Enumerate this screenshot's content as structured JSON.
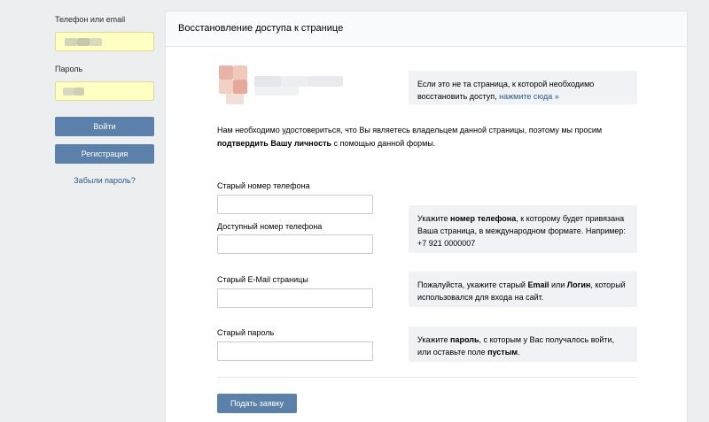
{
  "login": {
    "phone_label": "Телефон или email",
    "phone_value": "",
    "password_label": "Пароль",
    "password_value": "",
    "login_button": "Войти",
    "register_button": "Регистрация",
    "forgot_link": "Забыли пароль?",
    "input_bg_color": "#ffffc4"
  },
  "panel": {
    "title": "Восстановление доступа к странице"
  },
  "notice": {
    "text": "Если это не та страница, к которой необходимо восстановить доступ, ",
    "link": "нажмите сюда »"
  },
  "intro": {
    "part1": "Нам необходимо удостовериться, что Вы являетесь владельцем данной страницы, поэтому мы просим ",
    "bold": "подтвердить Вашу личность",
    "part2": " с помощью данной формы."
  },
  "form": {
    "old_phone_label": "Старый номер телефона",
    "available_phone_label": "Доступный номер телефона",
    "old_email_label": "Старый E-Mail страницы",
    "old_password_label": "Старый пароль",
    "submit_button": "Подать заявку"
  },
  "hints": {
    "phone": {
      "pre": "Укажите ",
      "bold": "номер телефона",
      "post": ", к которому будет привязана Ваша страница, в международном формате. Например: +7 921 0000007"
    },
    "email": {
      "pre": "Пожалуйста, укажите старый ",
      "bold1": "Email",
      "mid": " или ",
      "bold2": "Логин",
      "post": ", который использовался для входа на сайт."
    },
    "password": {
      "pre": "Укажите ",
      "bold1": "пароль",
      "mid": ", с которым у Вас получалось войти, или оставьте поле ",
      "bold2": "пустым",
      "post": "."
    }
  },
  "colors": {
    "page_bg": "#edeef0",
    "accent": "#5b80a9",
    "link": "#2a5885",
    "hint_bg": "#f0f2f5"
  }
}
